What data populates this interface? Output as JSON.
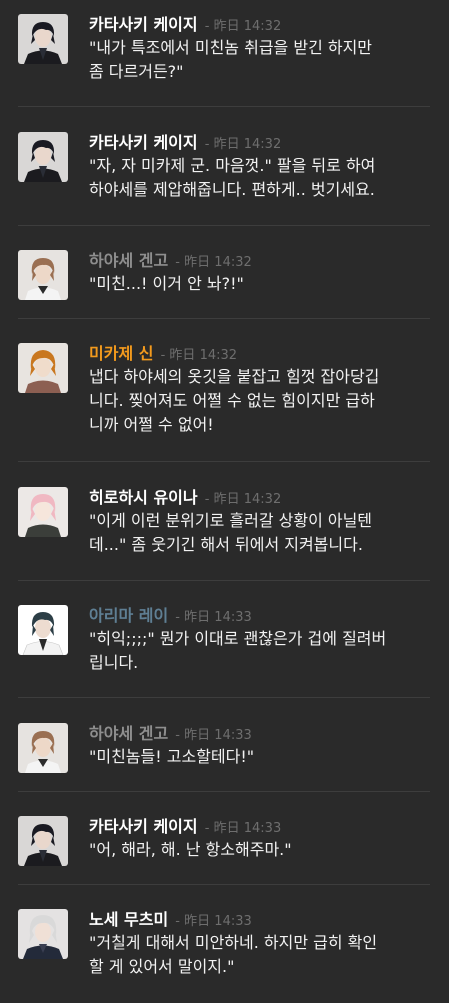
{
  "messages": [
    {
      "author": "카타사키 케이지",
      "date": "昨日",
      "time": "14:32",
      "text": "\"내가 특조에서 미친놈 취급을 받긴 하지만\n좀 다르거든?\"",
      "name_color": "#ffffff",
      "avatar": "dark-hair-man-black-suit"
    },
    {
      "author": "카타사키 케이지",
      "date": "昨日",
      "time": "14:32",
      "text": "\"자, 자 미카제 군. 마음껏.\" 팔을 뒤로 하여\n하야세를 제압해줍니다. 편하게.. 벗기세요.",
      "name_color": "#ffffff",
      "avatar": "dark-hair-man-black-suit"
    },
    {
      "author": "하야세 겐고",
      "date": "昨日",
      "time": "14:32",
      "text": "\"미친...! 이거 안 놔?!\"",
      "name_color": "#8e8e8e",
      "avatar": "brown-hair-man-white-shirt"
    },
    {
      "author": "미카제 신",
      "date": "昨日",
      "time": "14:32",
      "text": "냅다 하야세의 옷깃을 붙잡고 힘껏 잡아당깁\n니다. 찢어져도 어쩔 수 없는 힘이지만 급하\n니까 어쩔 수 없어!",
      "name_color": "#f39a1d",
      "avatar": "orange-hair-youth"
    },
    {
      "author": "히로하시 유이나",
      "date": "昨日",
      "time": "14:32",
      "text": "\"이게 이런 분위기로 흘러갈 상황이 아닐텐\n데...\" 좀 웃기긴 해서 뒤에서 지켜봅니다.",
      "name_color": "#ffffff",
      "avatar": "pink-hair-youth"
    },
    {
      "author": "아리마 레이",
      "date": "昨日",
      "time": "14:33",
      "text": "\"히익;;;;\" 뭔가 이대로 괜찮은가 겁에 질려버\n립니다.",
      "name_color": "#5f7f94",
      "avatar": "dark-hair-man-white-coat"
    },
    {
      "author": "하야세 겐고",
      "date": "昨日",
      "time": "14:33",
      "text": "\"미친놈들! 고소할테다!\"",
      "name_color": "#8e8e8e",
      "avatar": "brown-hair-man-white-shirt"
    },
    {
      "author": "카타사키 케이지",
      "date": "昨日",
      "time": "14:33",
      "text": "\"어, 해라, 해. 난 항소해주마.\"",
      "name_color": "#ffffff",
      "avatar": "dark-hair-man-black-suit"
    },
    {
      "author": "노세 무츠미",
      "date": "昨日",
      "time": "14:33",
      "text": "\"거칠게 대해서 미안하네. 하지만 급히 확인\n할 게 있어서 말이지.\"",
      "name_color": "#ffffff",
      "avatar": "white-hair-man"
    }
  ]
}
